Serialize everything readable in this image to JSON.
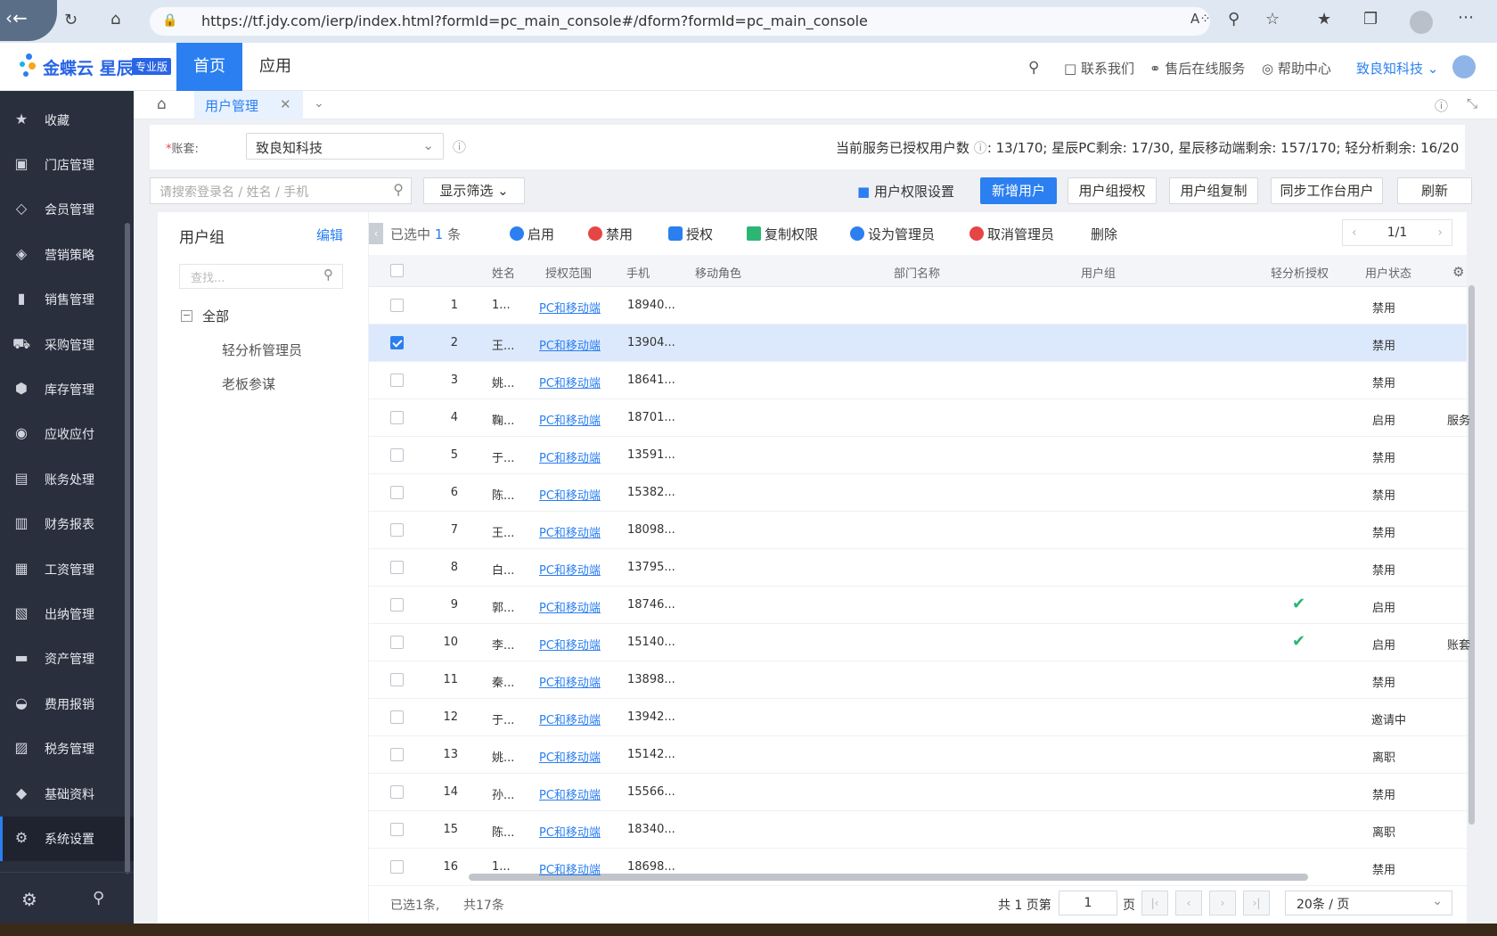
{
  "browser": {
    "url": "https://tf.jdy.com/ierp/index.html?formId=pc_main_console#/dform?formId=pc_main_console"
  },
  "header": {
    "logo_text": "金蝶云 星辰",
    "logo_badge": "专业版",
    "nav_home": "首页",
    "nav_app": "应用",
    "contact": "联系我们",
    "aftersale": "售后在线服务",
    "help": "帮助中心",
    "company": "致良知科技"
  },
  "sidebar": {
    "items": [
      {
        "label": "收藏",
        "icon": "star-icon",
        "glyph": "★"
      },
      {
        "label": "门店管理",
        "icon": "store-icon",
        "glyph": "▣"
      },
      {
        "label": "会员管理",
        "icon": "diamond-icon",
        "glyph": "◇"
      },
      {
        "label": "营销策略",
        "icon": "tag-icon",
        "glyph": "◈"
      },
      {
        "label": "销售管理",
        "icon": "bar-chart-icon",
        "glyph": "▮"
      },
      {
        "label": "采购管理",
        "icon": "cart-icon",
        "glyph": "⛟"
      },
      {
        "label": "库存管理",
        "icon": "box-icon",
        "glyph": "⬢"
      },
      {
        "label": "应收应付",
        "icon": "coin-icon",
        "glyph": "◉"
      },
      {
        "label": "账务处理",
        "icon": "ledger-icon",
        "glyph": "▤"
      },
      {
        "label": "财务报表",
        "icon": "report-icon",
        "glyph": "▥"
      },
      {
        "label": "工资管理",
        "icon": "wallet-icon",
        "glyph": "▦"
      },
      {
        "label": "出纳管理",
        "icon": "cashier-icon",
        "glyph": "▧"
      },
      {
        "label": "资产管理",
        "icon": "asset-icon",
        "glyph": "▬"
      },
      {
        "label": "费用报销",
        "icon": "reimburse-icon",
        "glyph": "◒"
      },
      {
        "label": "税务管理",
        "icon": "tax-icon",
        "glyph": "▨"
      },
      {
        "label": "基础资料",
        "icon": "layers-icon",
        "glyph": "◆"
      },
      {
        "label": "系统设置",
        "icon": "gear-icon",
        "glyph": "⚙"
      }
    ]
  },
  "tabs": {
    "user_mgmt": "用户管理"
  },
  "account": {
    "label": "账套:",
    "value": "致良知科技",
    "summary_prefix": "当前服务已授权用户数",
    "summary": ": 13/170; 星辰PC剩余: 17/30, 星辰移动端剩余: 157/170; 轻分析剩余: 16/20"
  },
  "toolbar": {
    "search_placeholder": "请搜索登录名 / 姓名 / 手机",
    "filter": "显示筛选",
    "perm_settings": "用户权限设置",
    "add_user": "新增用户",
    "group_auth": "用户组授权",
    "group_copy": "用户组复制",
    "sync": "同步工作台用户",
    "refresh": "刷新"
  },
  "groups": {
    "title": "用户组",
    "edit": "编辑",
    "search_placeholder": "查找...",
    "root": "全部",
    "children": [
      "轻分析管理员",
      "老板参谋"
    ]
  },
  "actions": {
    "selected_prefix": "已选中",
    "selected_count": "1",
    "selected_suffix": "条",
    "enable": "启用",
    "disable": "禁用",
    "authorize": "授权",
    "copy_perm": "复制权限",
    "set_admin": "设为管理员",
    "cancel_admin": "取消管理员",
    "delete": "删除",
    "page": "1/1"
  },
  "columns": [
    "姓名",
    "授权范围",
    "手机",
    "移动角色",
    "部门名称",
    "用户组",
    "轻分析授权",
    "用户状态"
  ],
  "rows": [
    {
      "no": "1",
      "name": "1...",
      "scope": "PC和移动端",
      "phone": "18940...",
      "analysis": false,
      "status": "禁用",
      "extra": "",
      "checked": false
    },
    {
      "no": "2",
      "name": "王...",
      "scope": "PC和移动端",
      "phone": "13904...",
      "analysis": false,
      "status": "禁用",
      "extra": "",
      "checked": true
    },
    {
      "no": "3",
      "name": "姚...",
      "scope": "PC和移动端",
      "phone": "18641...",
      "analysis": false,
      "status": "禁用",
      "extra": "",
      "checked": false
    },
    {
      "no": "4",
      "name": "鞠...",
      "scope": "PC和移动端",
      "phone": "18701...",
      "analysis": false,
      "status": "启用",
      "extra": "服务",
      "checked": false
    },
    {
      "no": "5",
      "name": "于...",
      "scope": "PC和移动端",
      "phone": "13591...",
      "analysis": false,
      "status": "禁用",
      "extra": "",
      "checked": false
    },
    {
      "no": "6",
      "name": "陈...",
      "scope": "PC和移动端",
      "phone": "15382...",
      "analysis": false,
      "status": "禁用",
      "extra": "",
      "checked": false
    },
    {
      "no": "7",
      "name": "王...",
      "scope": "PC和移动端",
      "phone": "18098...",
      "analysis": false,
      "status": "禁用",
      "extra": "",
      "checked": false
    },
    {
      "no": "8",
      "name": "白...",
      "scope": "PC和移动端",
      "phone": "13795...",
      "analysis": false,
      "status": "禁用",
      "extra": "",
      "checked": false
    },
    {
      "no": "9",
      "name": "郭...",
      "scope": "PC和移动端",
      "phone": "18746...",
      "analysis": true,
      "status": "启用",
      "extra": "",
      "checked": false
    },
    {
      "no": "10",
      "name": "李...",
      "scope": "PC和移动端",
      "phone": "15140...",
      "analysis": true,
      "status": "启用",
      "extra": "账套",
      "checked": false
    },
    {
      "no": "11",
      "name": "秦...",
      "scope": "PC和移动端",
      "phone": "13898...",
      "analysis": false,
      "status": "禁用",
      "extra": "",
      "checked": false
    },
    {
      "no": "12",
      "name": "于...",
      "scope": "PC和移动端",
      "phone": "13942...",
      "analysis": false,
      "status": "邀请中",
      "extra": "",
      "checked": false
    },
    {
      "no": "13",
      "name": "姚...",
      "scope": "PC和移动端",
      "phone": "15142...",
      "analysis": false,
      "status": "离职",
      "extra": "",
      "checked": false
    },
    {
      "no": "14",
      "name": "孙...",
      "scope": "PC和移动端",
      "phone": "15566...",
      "analysis": false,
      "status": "禁用",
      "extra": "",
      "checked": false
    },
    {
      "no": "15",
      "name": "陈...",
      "scope": "PC和移动端",
      "phone": "18340...",
      "analysis": false,
      "status": "离职",
      "extra": "",
      "checked": false
    },
    {
      "no": "16",
      "name": "1...",
      "scope": "PC和移动端",
      "phone": "18698...",
      "analysis": false,
      "status": "禁用",
      "extra": "",
      "checked": false
    }
  ],
  "footer": {
    "selected": "已选1条,",
    "total": "共17条",
    "pages_prefix": "共 1 页第",
    "page_value": "1",
    "pages_suffix": "页",
    "page_size": "20条 / 页"
  },
  "colors": {
    "accent": "#2b7ff0",
    "sidebar": "#2a2f3e",
    "check": "#2bb673",
    "danger": "#e64545"
  }
}
